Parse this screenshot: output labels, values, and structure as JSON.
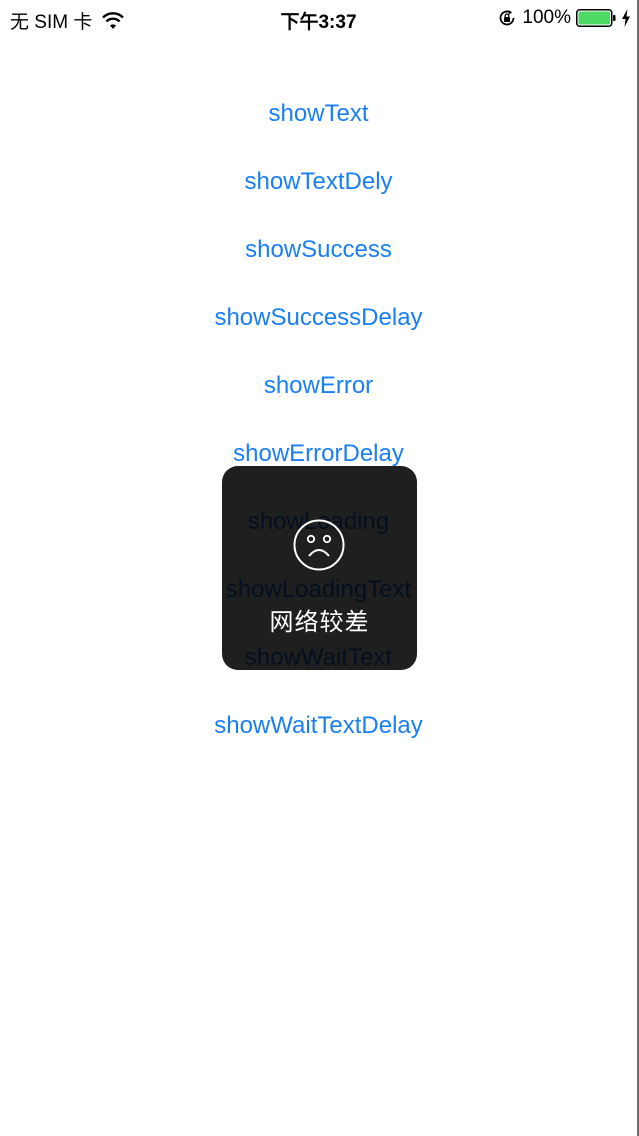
{
  "status_bar": {
    "carrier": "无 SIM 卡",
    "time": "下午3:37",
    "battery_percent": "100%",
    "icons": [
      "wifi-icon",
      "rotation-lock-icon",
      "battery-icon",
      "charging-bolt-icon"
    ]
  },
  "buttons": [
    {
      "label": "showText"
    },
    {
      "label": "showTextDely"
    },
    {
      "label": "showSuccess"
    },
    {
      "label": "showSuccessDelay"
    },
    {
      "label": "showError"
    },
    {
      "label": "showErrorDelay"
    },
    {
      "label": "showLoading"
    },
    {
      "label": "showLoadingText"
    },
    {
      "label": "showWaitText"
    },
    {
      "label": "showWaitTextDelay"
    }
  ],
  "hud": {
    "icon": "sad-face-icon",
    "message": "网络较差"
  },
  "colors": {
    "link": "#1a7ef5",
    "battery": "#4cd964",
    "hud_background": "#1c1c1c"
  }
}
